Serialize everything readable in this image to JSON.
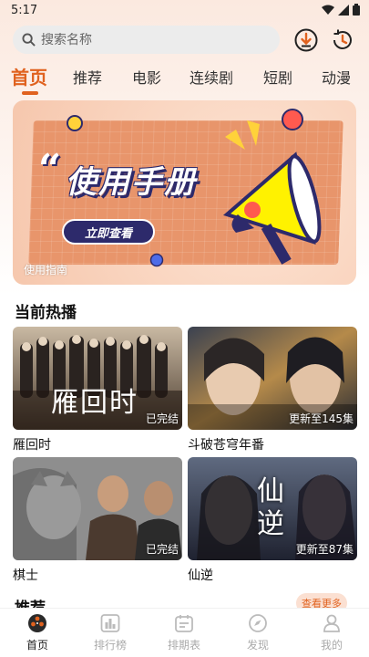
{
  "status": {
    "time": "5:17"
  },
  "search": {
    "placeholder": "搜索名称"
  },
  "tabs": [
    {
      "label": "首页",
      "active": true
    },
    {
      "label": "推荐"
    },
    {
      "label": "电影"
    },
    {
      "label": "连续剧"
    },
    {
      "label": "短剧"
    },
    {
      "label": "动漫"
    }
  ],
  "banner": {
    "title": "使用手册",
    "button": "立即查看",
    "caption": "使用指南"
  },
  "sections": {
    "hot": "当前热播",
    "recommend": "推荐",
    "more": "查看更多"
  },
  "media": [
    {
      "title": "雁回时",
      "status": "已完结",
      "poster_text": "雁回时"
    },
    {
      "title": "斗破苍穹年番",
      "status": "更新至145集"
    },
    {
      "title": "棋士",
      "status": "已完结"
    },
    {
      "title": "仙逆",
      "status": "更新至87集",
      "poster_text": "仙逆"
    }
  ],
  "nav": [
    {
      "label": "首页",
      "icon": "film-reel-icon",
      "active": true
    },
    {
      "label": "排行榜",
      "icon": "ranking-icon"
    },
    {
      "label": "排期表",
      "icon": "calendar-icon"
    },
    {
      "label": "发现",
      "icon": "discover-icon"
    },
    {
      "label": "我的",
      "icon": "profile-icon"
    }
  ],
  "colors": {
    "accent": "#e0621f",
    "banner_navy": "#2d2a6b"
  }
}
